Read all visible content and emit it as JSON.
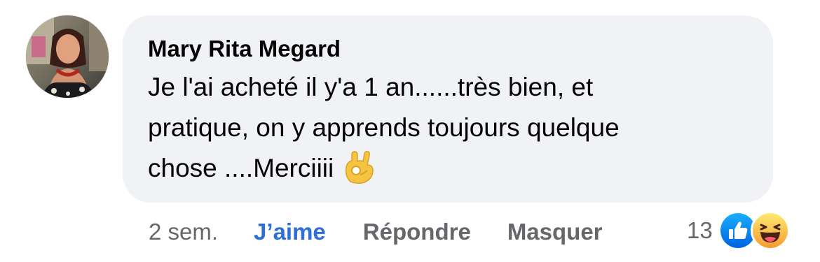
{
  "comment": {
    "author": "Mary Rita Megard",
    "text_lines": [
      "Je l'ai acheté il y'a 1 an......très bien, et",
      "pratique,  on y apprends toujours quelque",
      "chose  ....Merciiii"
    ],
    "emoji": "ok-hand-emoji"
  },
  "actions": {
    "timestamp": "2 sem.",
    "like_label": "J’aime",
    "reply_label": "Répondre",
    "hide_label": "Masquer"
  },
  "reactions": {
    "count": "13",
    "icons": [
      "like-reaction-icon",
      "haha-reaction-icon"
    ]
  },
  "colors": {
    "bubble_bg": "#f0f2f5",
    "text": "#050505",
    "secondary": "#65676b",
    "like_active": "#2d6fd6",
    "like_reaction": "#1877f2",
    "haha_reaction": "#f7b125"
  }
}
